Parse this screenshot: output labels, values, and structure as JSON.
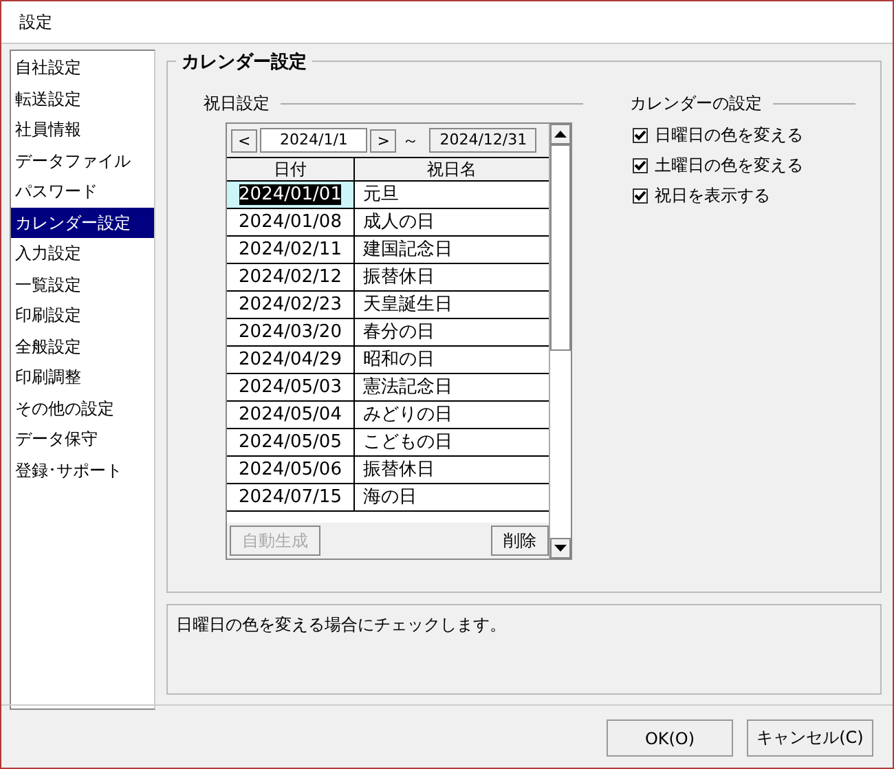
{
  "window": {
    "title": "設定"
  },
  "sidebar": {
    "items": [
      {
        "label": "自社設定",
        "selected": false
      },
      {
        "label": "転送設定",
        "selected": false
      },
      {
        "label": "社員情報",
        "selected": false
      },
      {
        "label": "データファイル",
        "selected": false
      },
      {
        "label": "パスワード",
        "selected": false
      },
      {
        "label": "カレンダー設定",
        "selected": true
      },
      {
        "label": "入力設定",
        "selected": false
      },
      {
        "label": "一覧設定",
        "selected": false
      },
      {
        "label": "印刷設定",
        "selected": false
      },
      {
        "label": "全般設定",
        "selected": false
      },
      {
        "label": "印刷調整",
        "selected": false
      },
      {
        "label": "その他の設定",
        "selected": false
      },
      {
        "label": "データ保守",
        "selected": false
      },
      {
        "label": "登録･サポート",
        "selected": false
      }
    ]
  },
  "panel": {
    "title": "カレンダー設定",
    "holidays": {
      "title": "祝日設定",
      "prev": "<",
      "start": "2024/1/1",
      "next": ">",
      "tilde": "～",
      "end": "2024/12/31",
      "columns": [
        "日付",
        "祝日名"
      ],
      "rows": [
        {
          "date": "2024/01/01",
          "name": "元旦",
          "selected": true
        },
        {
          "date": "2024/01/08",
          "name": "成人の日",
          "selected": false
        },
        {
          "date": "2024/02/11",
          "name": "建国記念日",
          "selected": false
        },
        {
          "date": "2024/02/12",
          "name": "振替休日",
          "selected": false
        },
        {
          "date": "2024/02/23",
          "name": "天皇誕生日",
          "selected": false
        },
        {
          "date": "2024/03/20",
          "name": "春分の日",
          "selected": false
        },
        {
          "date": "2024/04/29",
          "name": "昭和の日",
          "selected": false
        },
        {
          "date": "2024/05/03",
          "name": "憲法記念日",
          "selected": false
        },
        {
          "date": "2024/05/04",
          "name": "みどりの日",
          "selected": false
        },
        {
          "date": "2024/05/05",
          "name": "こどもの日",
          "selected": false
        },
        {
          "date": "2024/05/06",
          "name": "振替休日",
          "selected": false
        },
        {
          "date": "2024/07/15",
          "name": "海の日",
          "selected": false
        }
      ],
      "buttons": [
        {
          "label": "自動生成",
          "disabled": true
        },
        {
          "label": "削除",
          "disabled": false
        }
      ]
    },
    "calendar": {
      "title": "カレンダーの設定",
      "options": [
        {
          "label": "日曜日の色を変える",
          "checked": true
        },
        {
          "label": "土曜日の色を変える",
          "checked": true
        },
        {
          "label": "祝日を表示する",
          "checked": true
        }
      ]
    }
  },
  "help": "日曜日の色を変える場合にチェックします。",
  "buttons": [
    "OK(O)",
    "キャンセル(C)"
  ]
}
